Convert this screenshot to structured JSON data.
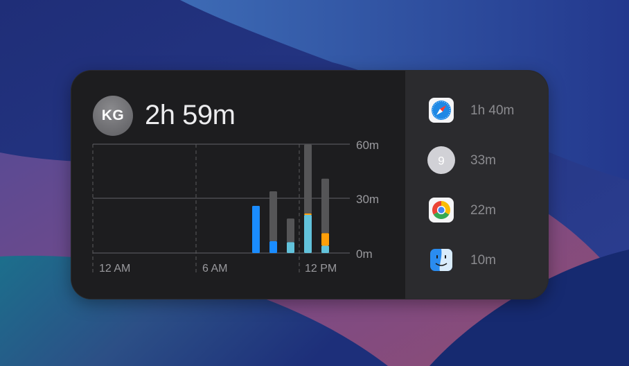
{
  "widget": {
    "avatar_initials": "KG",
    "total_time": "2h 59m"
  },
  "chart_data": {
    "type": "bar",
    "x_labels": [
      "12 AM",
      "6 AM",
      "12 PM"
    ],
    "y_ticks": [
      "60m",
      "30m",
      "0m"
    ],
    "ylim": [
      0,
      60
    ],
    "stacking": "stacked",
    "categories": [
      "9 AM",
      "10 AM",
      "11 AM",
      "12 PM",
      "1 PM"
    ],
    "series": [
      {
        "color": "#1a8cff",
        "values": [
          26,
          6.5,
          0,
          0,
          0
        ]
      },
      {
        "color": "#62c2db",
        "values": [
          0,
          0,
          6,
          21,
          4
        ]
      },
      {
        "color": "#ff9f0a",
        "values": [
          0,
          0,
          0,
          0.8,
          7
        ]
      },
      {
        "color": "#555557",
        "values": [
          0,
          27.5,
          13,
          38,
          30
        ]
      }
    ],
    "grid": true
  },
  "apps": [
    {
      "icon": "safari-icon",
      "time": "1h 40m"
    },
    {
      "icon": "number-nine-icon",
      "badge": "9",
      "time": "33m"
    },
    {
      "icon": "chrome-icon",
      "time": "22m"
    },
    {
      "icon": "finder-icon",
      "time": "10m"
    }
  ]
}
